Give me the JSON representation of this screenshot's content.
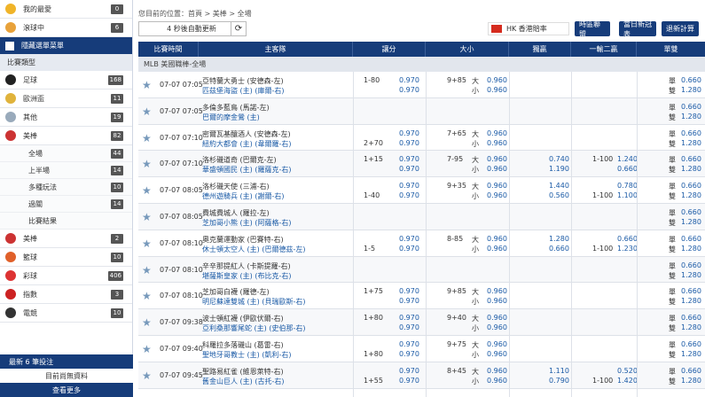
{
  "sidebar": {
    "top": [
      {
        "label": "我的最愛",
        "count": "0",
        "icon": "star-icon",
        "color": "#f0b429"
      },
      {
        "label": "滾球中",
        "count": "6",
        "icon": "live-icon",
        "color": "#e8a23a"
      }
    ],
    "hide_menu": "隱藏選單菜單",
    "section_title": "比賽類型",
    "sports": [
      {
        "label": "足球",
        "count": "168",
        "icon": "soccer-icon",
        "color": "#222"
      },
      {
        "label": "歐洲盃",
        "count": "11",
        "icon": "trophy-icon",
        "color": "#e0b33c"
      },
      {
        "label": "其他",
        "count": "19",
        "icon": "other-sports-icon",
        "color": "#9ab"
      },
      {
        "label": "美棒",
        "count": "82",
        "icon": "baseball-icon",
        "color": "#c33"
      }
    ],
    "sub_items": [
      {
        "label": "全場",
        "count": "44"
      },
      {
        "label": "上半場",
        "count": "14"
      },
      {
        "label": "多種玩法",
        "count": "10"
      },
      {
        "label": "過關",
        "count": "14"
      },
      {
        "label": "比賽結果",
        "count": ""
      }
    ],
    "sports2": [
      {
        "label": "美棒",
        "count": "2",
        "icon": "baseball2-icon",
        "color": "#c33"
      },
      {
        "label": "籃球",
        "count": "10",
        "icon": "basketball-icon",
        "color": "#e0602a"
      },
      {
        "label": "彩球",
        "count": "406",
        "icon": "lottery-icon",
        "color": "#d33"
      },
      {
        "label": "指數",
        "count": "3",
        "icon": "index-icon",
        "color": "#c22"
      },
      {
        "label": "電競",
        "count": "10",
        "icon": "esports-icon",
        "color": "#333"
      }
    ],
    "recent_title": "最新 6 筆投注",
    "recent_link": "目前尚無資料",
    "more": "查看更多"
  },
  "header": {
    "breadcrumb": "您目前的位置：首頁 > 美棒 > 全場",
    "refresh_label": "4 秒後自動更新",
    "odds_type": "HK 香港賠率",
    "buttons": [
      "時區聯盟",
      "當日新冠表",
      "退新計算"
    ]
  },
  "table": {
    "columns": [
      "比賽時間",
      "主客隊",
      "讓分",
      "大小",
      "獨贏",
      "一輸二贏",
      "單雙"
    ],
    "league": "MLB 美國職棒-全場",
    "rows": [
      {
        "time": "07-07 07:05",
        "home": "亞特蘭大勇士 (安德森-左)",
        "away": "匹茲堡海盜 (主)  (庫爾-右)",
        "hcp_a": "1-80",
        "hcp_ao": "0.970",
        "hcp_b": "",
        "hcp_bo": "0.970",
        "ou_line": "9+85",
        "ou_big": "大",
        "ou_bo": "0.960",
        "ou_small": "小",
        "ou_so": "0.960",
        "ml_a": "",
        "ml_b": "",
        "w2_line_a": "",
        "w2_a": "",
        "w2_line_b": "",
        "w2_b": "",
        "oe_a": "單",
        "oe_ao": "0.660",
        "oe_b": "雙",
        "oe_bo": "1.280"
      },
      {
        "time": "07-07 07:05",
        "home": "多倫多藍鳥 (馬諾-左)",
        "away": "巴爾的摩金鶯 (主)",
        "hcp_a": "",
        "hcp_ao": "",
        "hcp_b": "",
        "hcp_bo": "",
        "ou_line": "",
        "ou_big": "",
        "ou_bo": "",
        "ou_small": "",
        "ou_so": "",
        "ml_a": "",
        "ml_b": "",
        "w2_line_a": "",
        "w2_a": "",
        "w2_line_b": "",
        "w2_b": "",
        "oe_a": "單",
        "oe_ao": "0.660",
        "oe_b": "雙",
        "oe_bo": "1.280"
      },
      {
        "time": "07-07 07:10",
        "home": "密爾瓦基釀酒人 (安德森-左)",
        "away": "紐約大都會 (主)  (韋爾羅-右)",
        "hcp_a": "",
        "hcp_ao": "0.970",
        "hcp_b": "2+70",
        "hcp_bo": "0.970",
        "ou_line": "7+65",
        "ou_big": "大",
        "ou_bo": "0.960",
        "ou_small": "小",
        "ou_so": "0.960",
        "ml_a": "",
        "ml_b": "",
        "w2_line_a": "",
        "w2_a": "",
        "w2_line_b": "",
        "w2_b": "",
        "oe_a": "單",
        "oe_ao": "0.660",
        "oe_b": "雙",
        "oe_bo": "1.280"
      },
      {
        "time": "07-07 07:10",
        "home": "洛杉磯道奇 (巴爾克-左)",
        "away": "華盛頓國民 (主)  (羅薩克-右)",
        "hcp_a": "1+15",
        "hcp_ao": "0.970",
        "hcp_b": "",
        "hcp_bo": "0.970",
        "ou_line": "7-95",
        "ou_big": "大",
        "ou_bo": "0.960",
        "ou_small": "小",
        "ou_so": "0.960",
        "ml_a": "0.740",
        "ml_b": "1.190",
        "w2_line_a": "1-100",
        "w2_a": "1.240",
        "w2_line_b": "",
        "w2_b": "0.660",
        "oe_a": "單",
        "oe_ao": "0.660",
        "oe_b": "雙",
        "oe_bo": "1.280"
      },
      {
        "time": "07-07 08:05",
        "home": "洛杉磯天使 (三浦-右)",
        "away": "德州遊騎兵 (主)  (謝爾-右)",
        "hcp_a": "",
        "hcp_ao": "0.970",
        "hcp_b": "1-40",
        "hcp_bo": "0.970",
        "ou_line": "9+35",
        "ou_big": "大",
        "ou_bo": "0.960",
        "ou_small": "小",
        "ou_so": "0.960",
        "ml_a": "1.440",
        "ml_b": "0.560",
        "w2_line_a": "",
        "w2_a": "0.780",
        "w2_line_b": "1-100",
        "w2_b": "1.100",
        "oe_a": "單",
        "oe_ao": "0.660",
        "oe_b": "雙",
        "oe_bo": "1.280"
      },
      {
        "time": "07-07 08:05",
        "home": "費城費城人 (羅拉-左)",
        "away": "芝加哥小熊 (主)  (阿薩格-右)",
        "hcp_a": "",
        "hcp_ao": "",
        "hcp_b": "",
        "hcp_bo": "",
        "ou_line": "",
        "ou_big": "",
        "ou_bo": "",
        "ou_small": "",
        "ou_so": "",
        "ml_a": "",
        "ml_b": "",
        "w2_line_a": "",
        "w2_a": "",
        "w2_line_b": "",
        "w2_b": "",
        "oe_a": "單",
        "oe_ao": "0.660",
        "oe_b": "雙",
        "oe_bo": "1.280"
      },
      {
        "time": "07-07 08:10",
        "home": "奧克蘭運動家 (巴賽特-右)",
        "away": "休士頓太空人 (主)  (巴爾德茲-左)",
        "hcp_a": "",
        "hcp_ao": "0.970",
        "hcp_b": "1-5",
        "hcp_bo": "0.970",
        "ou_line": "8-85",
        "ou_big": "大",
        "ou_bo": "0.960",
        "ou_small": "小",
        "ou_so": "0.960",
        "ml_a": "1.280",
        "ml_b": "0.660",
        "w2_line_a": "",
        "w2_a": "0.660",
        "w2_line_b": "1-100",
        "w2_b": "1.230",
        "oe_a": "單",
        "oe_ao": "0.660",
        "oe_b": "雙",
        "oe_bo": "1.280"
      },
      {
        "time": "07-07 08:10",
        "home": "辛辛那提紅人 (卡斯提羅-右)",
        "away": "堪薩斯皇家 (主)  (布比克-右)",
        "hcp_a": "",
        "hcp_ao": "",
        "hcp_b": "",
        "hcp_bo": "",
        "ou_line": "",
        "ou_big": "",
        "ou_bo": "",
        "ou_small": "",
        "ou_so": "",
        "ml_a": "",
        "ml_b": "",
        "w2_line_a": "",
        "w2_a": "",
        "w2_line_b": "",
        "w2_b": "",
        "oe_a": "單",
        "oe_ao": "0.660",
        "oe_b": "雙",
        "oe_bo": "1.280"
      },
      {
        "time": "07-07 08:10",
        "home": "芝加哥白襪 (羅德-左)",
        "away": "明尼蘇達雙城 (主)  (貝瑞歐斯-右)",
        "hcp_a": "1+75",
        "hcp_ao": "0.970",
        "hcp_b": "",
        "hcp_bo": "0.970",
        "ou_line": "9+85",
        "ou_big": "大",
        "ou_bo": "0.960",
        "ou_small": "小",
        "ou_so": "0.960",
        "ml_a": "",
        "ml_b": "",
        "w2_line_a": "",
        "w2_a": "",
        "w2_line_b": "",
        "w2_b": "",
        "oe_a": "單",
        "oe_ao": "0.660",
        "oe_b": "雙",
        "oe_bo": "1.280"
      },
      {
        "time": "07-07 09:38",
        "home": "波士頓紅襪 (伊歐伏爾-右)",
        "away": "亞利桑那響尾蛇 (主)  (史伯那-右)",
        "hcp_a": "1+80",
        "hcp_ao": "0.970",
        "hcp_b": "",
        "hcp_bo": "0.970",
        "ou_line": "9+40",
        "ou_big": "大",
        "ou_bo": "0.960",
        "ou_small": "小",
        "ou_so": "0.960",
        "ml_a": "",
        "ml_b": "",
        "w2_line_a": "",
        "w2_a": "",
        "w2_line_b": "",
        "w2_b": "",
        "oe_a": "單",
        "oe_ao": "0.660",
        "oe_b": "雙",
        "oe_bo": "1.280"
      },
      {
        "time": "07-07 09:40",
        "home": "科羅拉多落磯山 (葛雷-右)",
        "away": "聖地牙哥教士 (主)  (凱利-右)",
        "hcp_a": "",
        "hcp_ao": "0.970",
        "hcp_b": "1+80",
        "hcp_bo": "0.970",
        "ou_line": "9+75",
        "ou_big": "大",
        "ou_bo": "0.960",
        "ou_small": "小",
        "ou_so": "0.960",
        "ml_a": "",
        "ml_b": "",
        "w2_line_a": "",
        "w2_a": "",
        "w2_line_b": "",
        "w2_b": "",
        "oe_a": "單",
        "oe_ao": "0.660",
        "oe_b": "雙",
        "oe_bo": "1.280"
      },
      {
        "time": "07-07 09:45",
        "home": "聖路易紅雀 (維恩萊特-右)",
        "away": "舊金山巨人 (主)  (古托-右)",
        "hcp_a": "",
        "hcp_ao": "0.970",
        "hcp_b": "1+55",
        "hcp_bo": "0.970",
        "ou_line": "8+45",
        "ou_big": "大",
        "ou_bo": "0.960",
        "ou_small": "小",
        "ou_so": "0.960",
        "ml_a": "1.110",
        "ml_b": "0.790",
        "w2_line_a": "",
        "w2_a": "0.520",
        "w2_line_b": "1-100",
        "w2_b": "1.420",
        "oe_a": "單",
        "oe_ao": "0.660",
        "oe_b": "雙",
        "oe_bo": "1.280"
      }
    ]
  }
}
